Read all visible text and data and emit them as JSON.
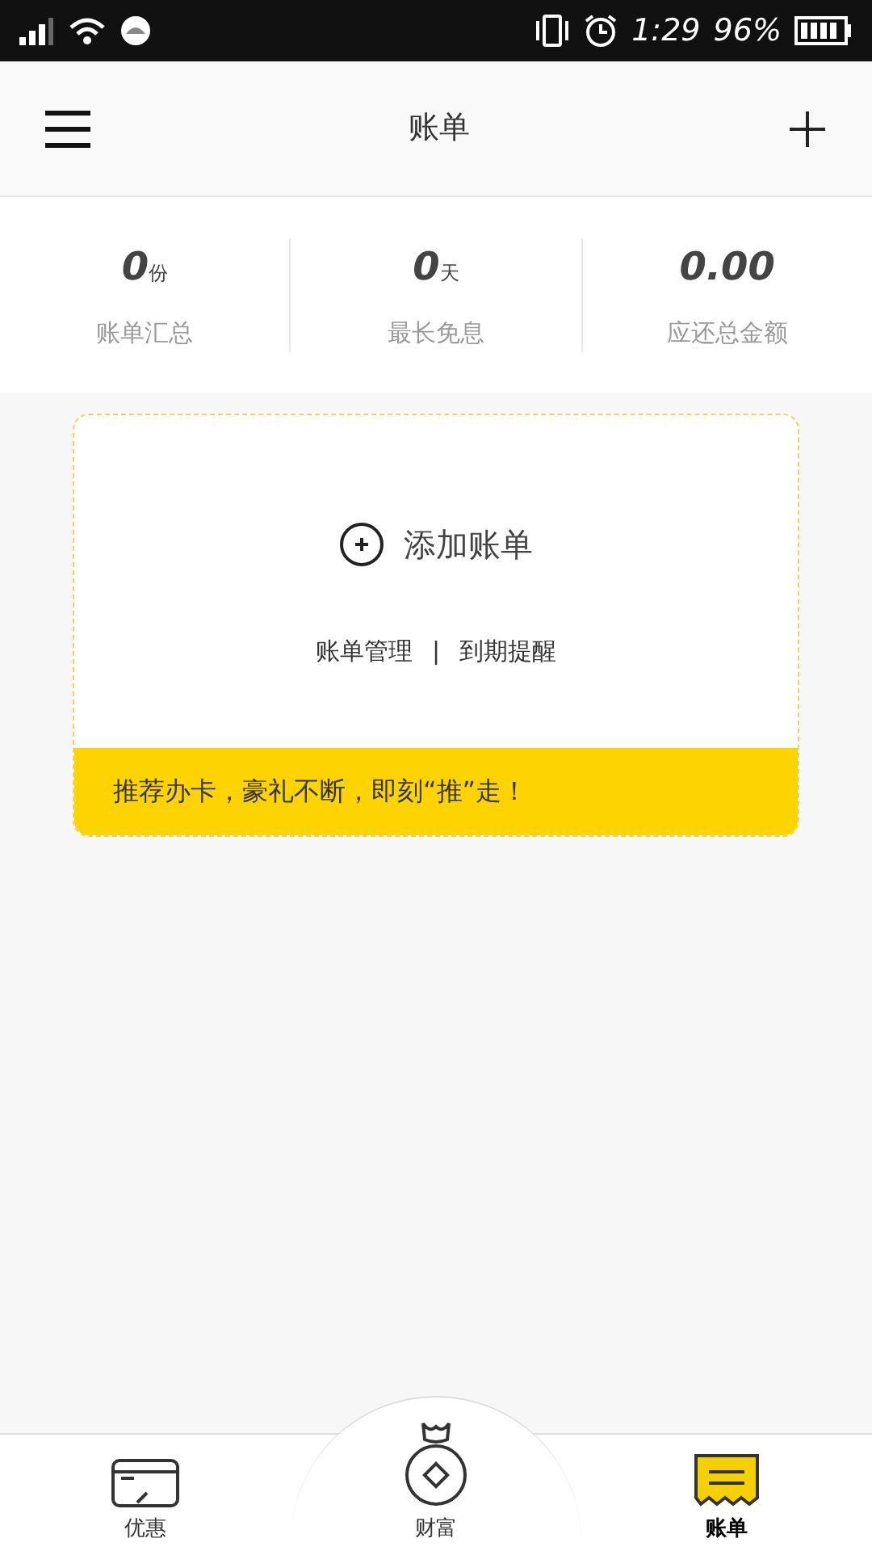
{
  "status_bar": {
    "time": "1:29",
    "battery": "96%"
  },
  "header": {
    "title": "账单"
  },
  "stats": [
    {
      "value": "0",
      "unit": "份",
      "label": "账单汇总"
    },
    {
      "value": "0",
      "unit": "天",
      "label": "最长免息"
    },
    {
      "value": "0.00",
      "label": "应还总金额"
    }
  ],
  "card": {
    "add_label": "添加账单",
    "links": [
      "账单管理",
      "到期提醒"
    ],
    "separator": "|",
    "promo": "推荐办卡，豪礼不断，即刻“推”走！"
  },
  "tabs": [
    {
      "label": "优惠",
      "kind": "card",
      "selected": false
    },
    {
      "label": "财富",
      "kind": "coin",
      "selected": false
    },
    {
      "label": "账单",
      "kind": "bill",
      "selected": true
    }
  ]
}
